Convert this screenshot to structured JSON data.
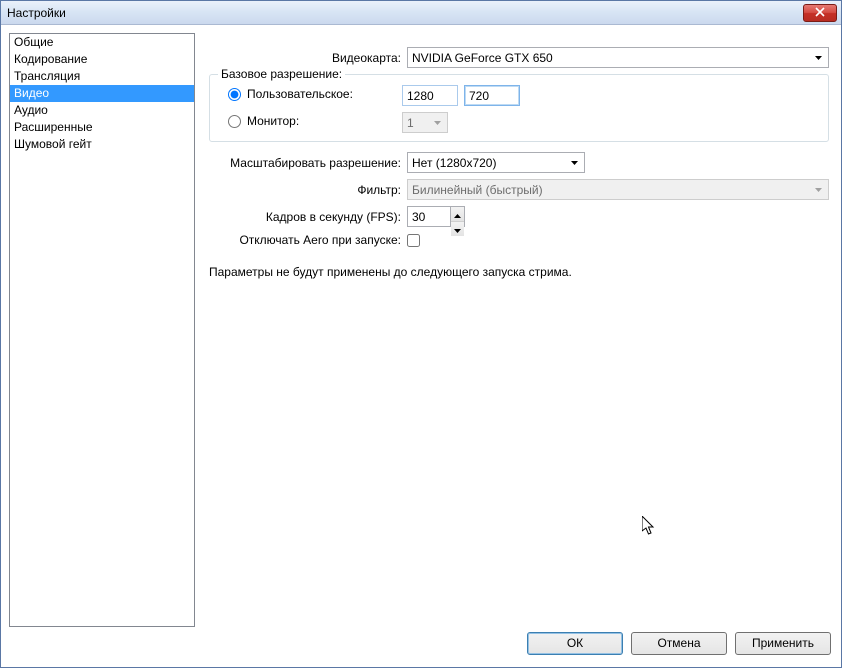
{
  "window": {
    "title": "Настройки"
  },
  "sidebar": {
    "items": [
      {
        "label": "Общие"
      },
      {
        "label": "Кодирование"
      },
      {
        "label": "Трансляция"
      },
      {
        "label": "Видео",
        "selected": true
      },
      {
        "label": "Аудио"
      },
      {
        "label": "Расширенные"
      },
      {
        "label": "Шумовой гейт"
      }
    ]
  },
  "content": {
    "videocard_label": "Видеокарта:",
    "videocard_value": "NVIDIA GeForce GTX 650",
    "base_res": {
      "legend": "Базовое разрешение:",
      "custom_label": "Пользовательское:",
      "custom_w": "1280",
      "custom_h": "720",
      "monitor_label": "Монитор:",
      "monitor_value": "1"
    },
    "scale_label": "Масштабировать разрешение:",
    "scale_value": "Нет  (1280x720)",
    "filter_label": "Фильтр:",
    "filter_value": "Билинейный (быстрый)",
    "fps_label": "Кадров в секунду (FPS):",
    "fps_value": "30",
    "aero_label": "Отключать Aero при запуске:",
    "note": "Параметры не будут применены до следующего запуска стрима."
  },
  "buttons": {
    "ok": "ОК",
    "cancel": "Отмена",
    "apply": "Применить"
  }
}
